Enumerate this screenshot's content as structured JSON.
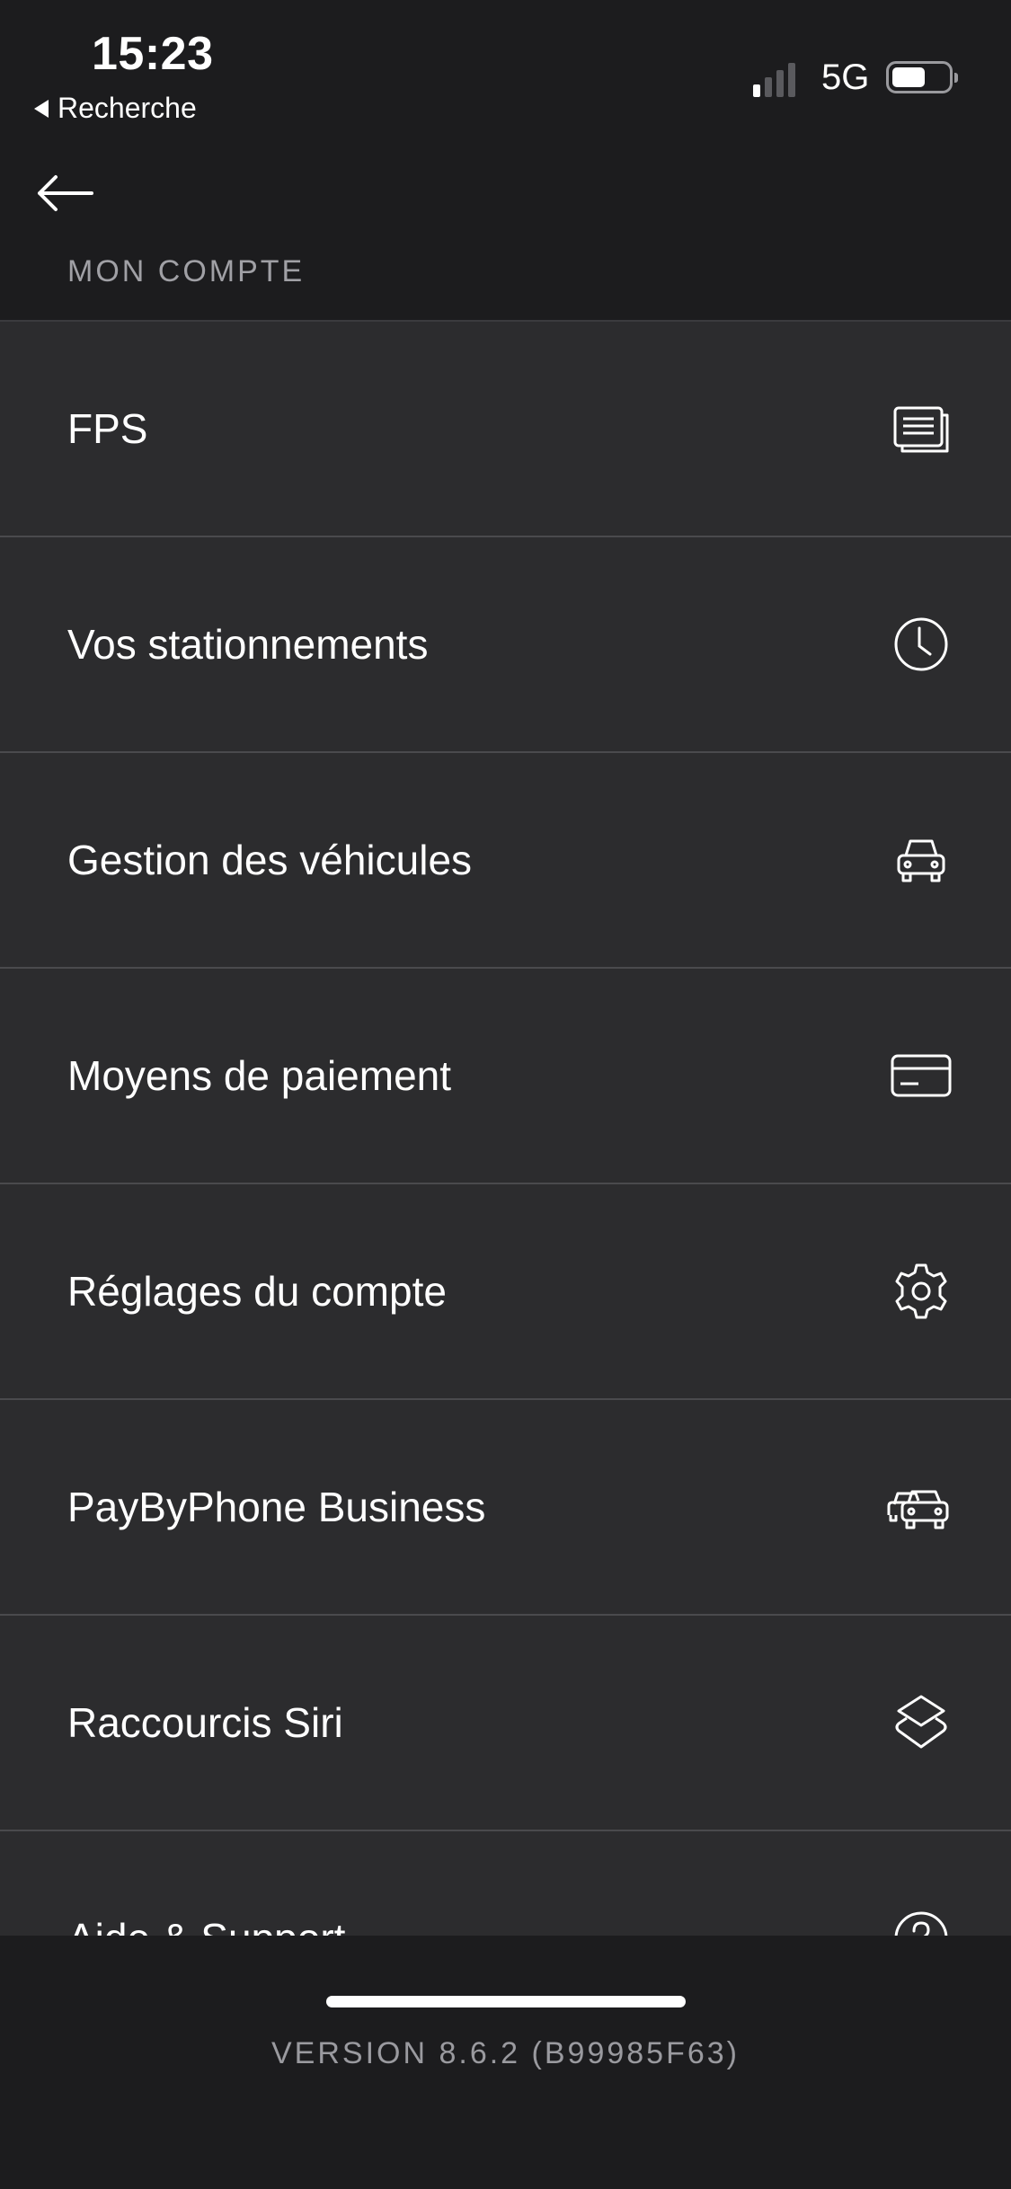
{
  "status_bar": {
    "time": "15:23",
    "back_to_app": "Recherche",
    "network": "5G",
    "battery_level": 0.6
  },
  "nav": {
    "back_icon": "arrow-left-icon"
  },
  "section_title": "MON COMPTE",
  "menu": [
    {
      "label": "FPS",
      "icon": "documents-icon"
    },
    {
      "label": "Vos stationnements",
      "icon": "clock-icon"
    },
    {
      "label": "Gestion des véhicules",
      "icon": "car-icon"
    },
    {
      "label": "Moyens de paiement",
      "icon": "credit-card-icon"
    },
    {
      "label": "Réglages du compte",
      "icon": "gear-icon"
    },
    {
      "label": "PayByPhone Business",
      "icon": "cars-icon"
    },
    {
      "label": "Raccourcis Siri",
      "icon": "siri-shortcuts-icon"
    },
    {
      "label": "Aide & Support",
      "icon": "help-icon"
    }
  ],
  "footer": {
    "version": "VERSION 8.6.2 (B99985F63)"
  },
  "colors": {
    "background": "#1c1c1e",
    "row": "#2c2c2e",
    "divider": "#4a4a4d",
    "muted_text": "#9a9a9f"
  }
}
